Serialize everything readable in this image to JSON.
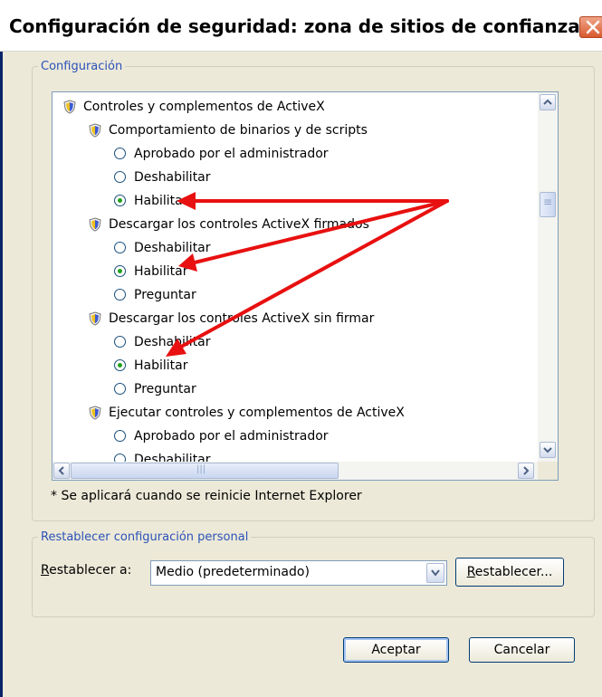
{
  "window": {
    "title": "Configuración de seguridad: zona de sitios de confianza"
  },
  "settings_group": {
    "legend": "Configuración",
    "tree": [
      {
        "type": "category",
        "label": "Controles y complementos de ActiveX",
        "indent": 0
      },
      {
        "type": "setting",
        "label": "Comportamiento de binarios y de scripts",
        "indent": 1
      },
      {
        "type": "option",
        "label": "Aprobado por el administrador",
        "checked": false
      },
      {
        "type": "option",
        "label": "Deshabilitar",
        "checked": false
      },
      {
        "type": "option",
        "label": "Habilitar",
        "checked": true
      },
      {
        "type": "setting",
        "label": "Descargar los controles ActiveX firmados",
        "indent": 1
      },
      {
        "type": "option",
        "label": "Deshabilitar",
        "checked": false
      },
      {
        "type": "option",
        "label": "Habilitar",
        "checked": true
      },
      {
        "type": "option",
        "label": "Preguntar",
        "checked": false
      },
      {
        "type": "setting",
        "label": "Descargar los controles ActiveX sin firmar",
        "indent": 1
      },
      {
        "type": "option",
        "label": "Deshabilitar",
        "checked": false
      },
      {
        "type": "option",
        "label": "Habilitar",
        "checked": true
      },
      {
        "type": "option",
        "label": "Preguntar",
        "checked": false
      },
      {
        "type": "setting",
        "label": "Ejecutar controles y complementos de ActiveX",
        "indent": 1
      },
      {
        "type": "option",
        "label": "Aprobado por el administrador",
        "checked": false
      },
      {
        "type": "option",
        "label": "Deshabilitar",
        "checked": false
      }
    ],
    "note": "* Se aplicará cuando se reinicie Internet Explorer"
  },
  "reset_group": {
    "legend": "Restablecer configuración personal",
    "label": "Restablecer a:",
    "selected": "Medio (predeterminado)",
    "reset_button": "Restablecer..."
  },
  "buttons": {
    "ok": "Aceptar",
    "cancel": "Cancelar"
  },
  "colors": {
    "annotation_arrow": "#e81010",
    "legend_text": "#2c52b8",
    "radio_dot": "#21a121"
  }
}
